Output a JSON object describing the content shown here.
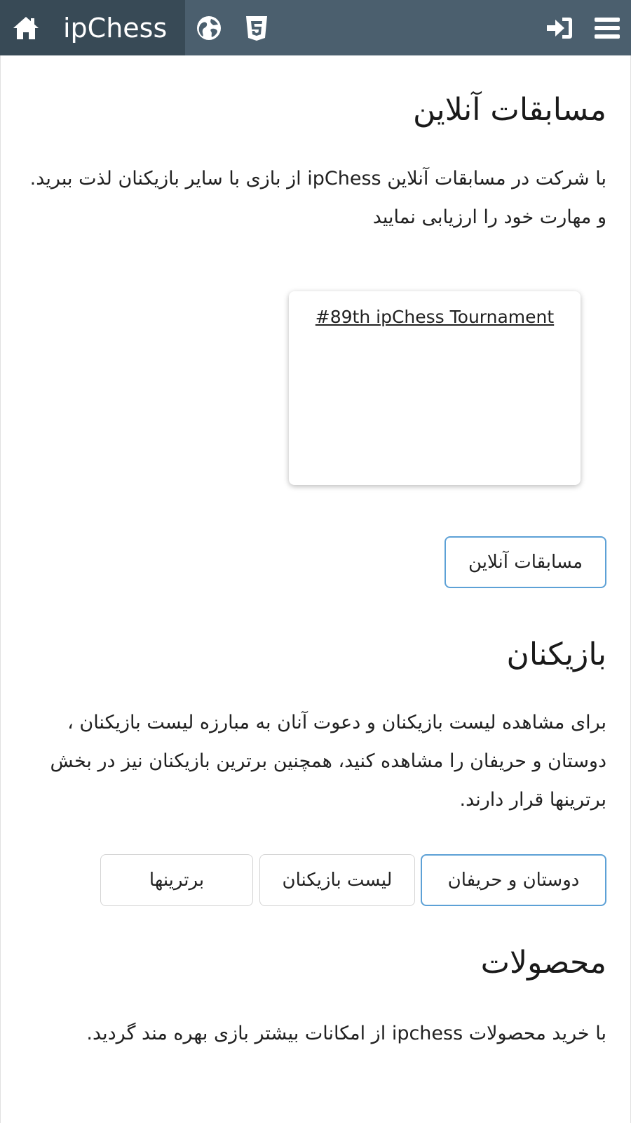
{
  "topbar": {
    "brand": "ipChess",
    "icons": {
      "home": "home-icon",
      "globe": "globe-icon",
      "html5": "html5-icon",
      "login": "sign-in-icon",
      "menu": "hamburger-menu-icon"
    },
    "colors": {
      "bar": "#4b5f6e",
      "brand_bg": "#384a56"
    }
  },
  "tournaments": {
    "title": "مسابقات آنلاین",
    "description": "با شرکت در مسابقات آنلاین ipChess از بازی با سایر بازیکنان لذت ببرید. و مهارت خود را ارزیابی نمایید",
    "card_link": "#89th ipChess Tournament",
    "button": "مسابقات آنلاین"
  },
  "players": {
    "title": "بازیکنان",
    "description": "برای مشاهده لیست بازیکنان و دعوت آنان به مبارزه لیست بازیکنان ، دوستان و حریفان را مشاهده کنید، همچنین برترین بازیکنان نیز در بخش برترینها قرار دارند.",
    "buttons": {
      "friends": "دوستان و حریفان",
      "list": "لیست بازیکنان",
      "top": "برترینها"
    }
  },
  "products": {
    "title": "محصولات",
    "description": "با خرید محصولات ipchess از امکانات بیشتر بازی بهره مند گردید."
  },
  "colors": {
    "primary_border": "#5da1d6"
  }
}
